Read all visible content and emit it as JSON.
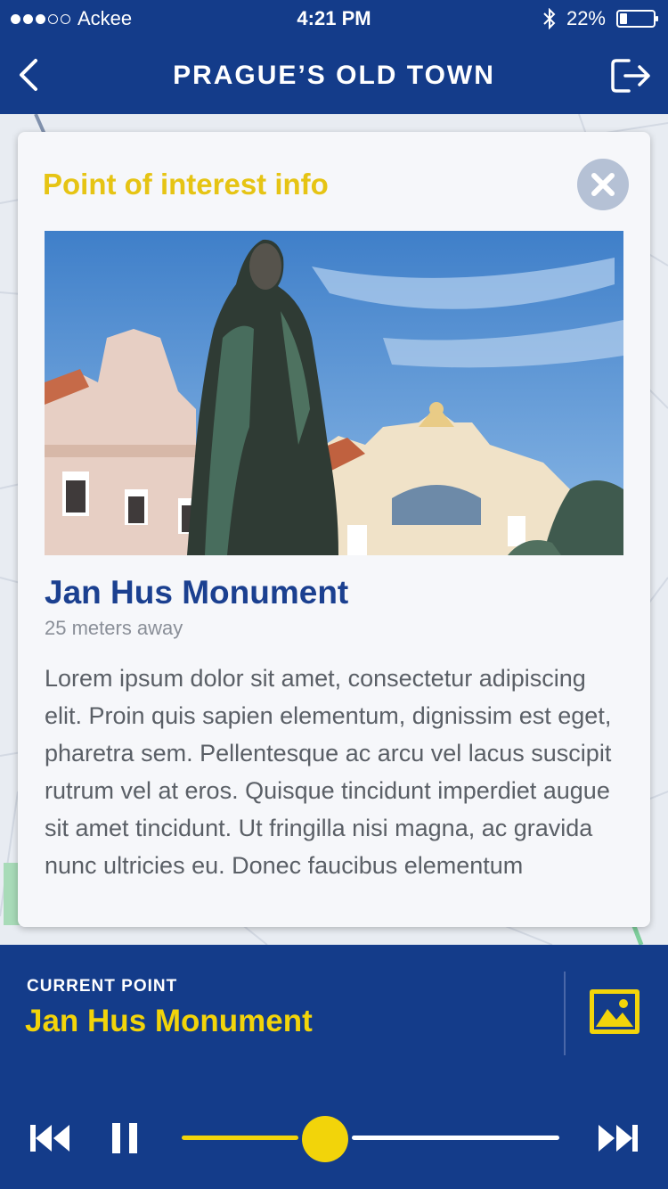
{
  "status_bar": {
    "carrier": "Ackee",
    "time": "4:21 PM",
    "battery": "22%",
    "battery_level": 0.22,
    "signal_strength": 3,
    "signal_max": 5
  },
  "nav": {
    "title": "PRAGUE’S OLD TOWN",
    "back_icon": "chevron-left-icon",
    "exit_icon": "exit-icon"
  },
  "card": {
    "header": "Point of interest info",
    "close_icon": "close-icon",
    "poi_title": "Jan Hus Monument",
    "distance": "25 meters away",
    "description": "Lorem ipsum dolor sit amet, consectetur adipiscing elit. Proin quis sapien elementum, dignissim est eget, pharetra sem. Pellentesque ac arcu vel lacus suscipit rutrum vel at eros. Quisque tincidunt imperdiet augue sit amet tincidunt. Ut fringilla nisi magna, ac gravida nunc ultricies eu. Donec faucibus elementum"
  },
  "player": {
    "label": "CURRENT POINT",
    "title": "Jan Hus Monument",
    "progress": 0.38,
    "gallery_icon": "image-icon",
    "prev_icon": "skip-back-icon",
    "pause_icon": "pause-icon",
    "next_icon": "skip-forward-icon"
  },
  "colors": {
    "brand_blue": "#143c8a",
    "accent_yellow": "#f2d40a",
    "title_blue": "#1b4090"
  }
}
